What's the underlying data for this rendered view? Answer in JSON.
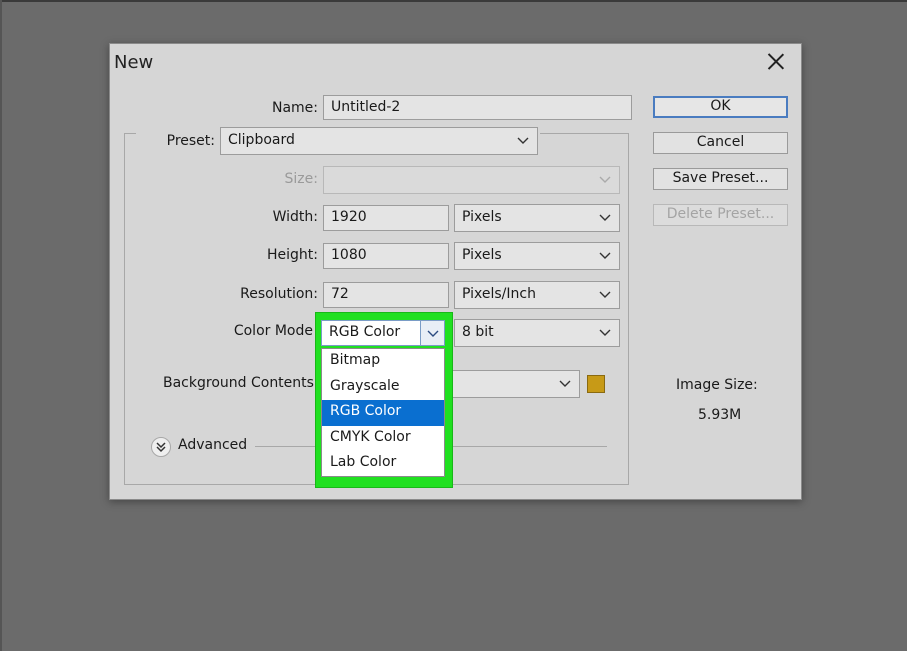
{
  "dialog": {
    "title": "New",
    "name": {
      "label": "Name:",
      "value": "Untitled-2"
    },
    "preset": {
      "label": "Preset:",
      "value": "Clipboard"
    },
    "size": {
      "label": "Size:",
      "value": ""
    },
    "width": {
      "label": "Width:",
      "value": "1920",
      "unit": "Pixels"
    },
    "height": {
      "label": "Height:",
      "value": "1080",
      "unit": "Pixels"
    },
    "resolution": {
      "label": "Resolution:",
      "value": "72",
      "unit": "Pixels/Inch"
    },
    "color_mode": {
      "label": "Color Mode",
      "value": "RGB Color",
      "bit_depth": "8 bit",
      "options": [
        "Bitmap",
        "Grayscale",
        "RGB Color",
        "CMYK Color",
        "Lab Color"
      ],
      "selected_index": 2
    },
    "background_contents": {
      "label": "Background Contents",
      "value": "",
      "swatch_color": "#c79a17"
    },
    "advanced": {
      "label": "Advanced"
    },
    "buttons": {
      "ok": "OK",
      "cancel": "Cancel",
      "save_preset": "Save Preset...",
      "delete_preset": "Delete Preset..."
    },
    "image_size": {
      "label": "Image Size:",
      "value": "5.93M"
    }
  },
  "colors": {
    "highlight": "#20e020",
    "selection": "#0a6fd0",
    "ok_border": "#4a7cc0"
  },
  "icons": [
    "close-icon",
    "chevron-down-icon",
    "expand-chevrons-icon"
  ]
}
